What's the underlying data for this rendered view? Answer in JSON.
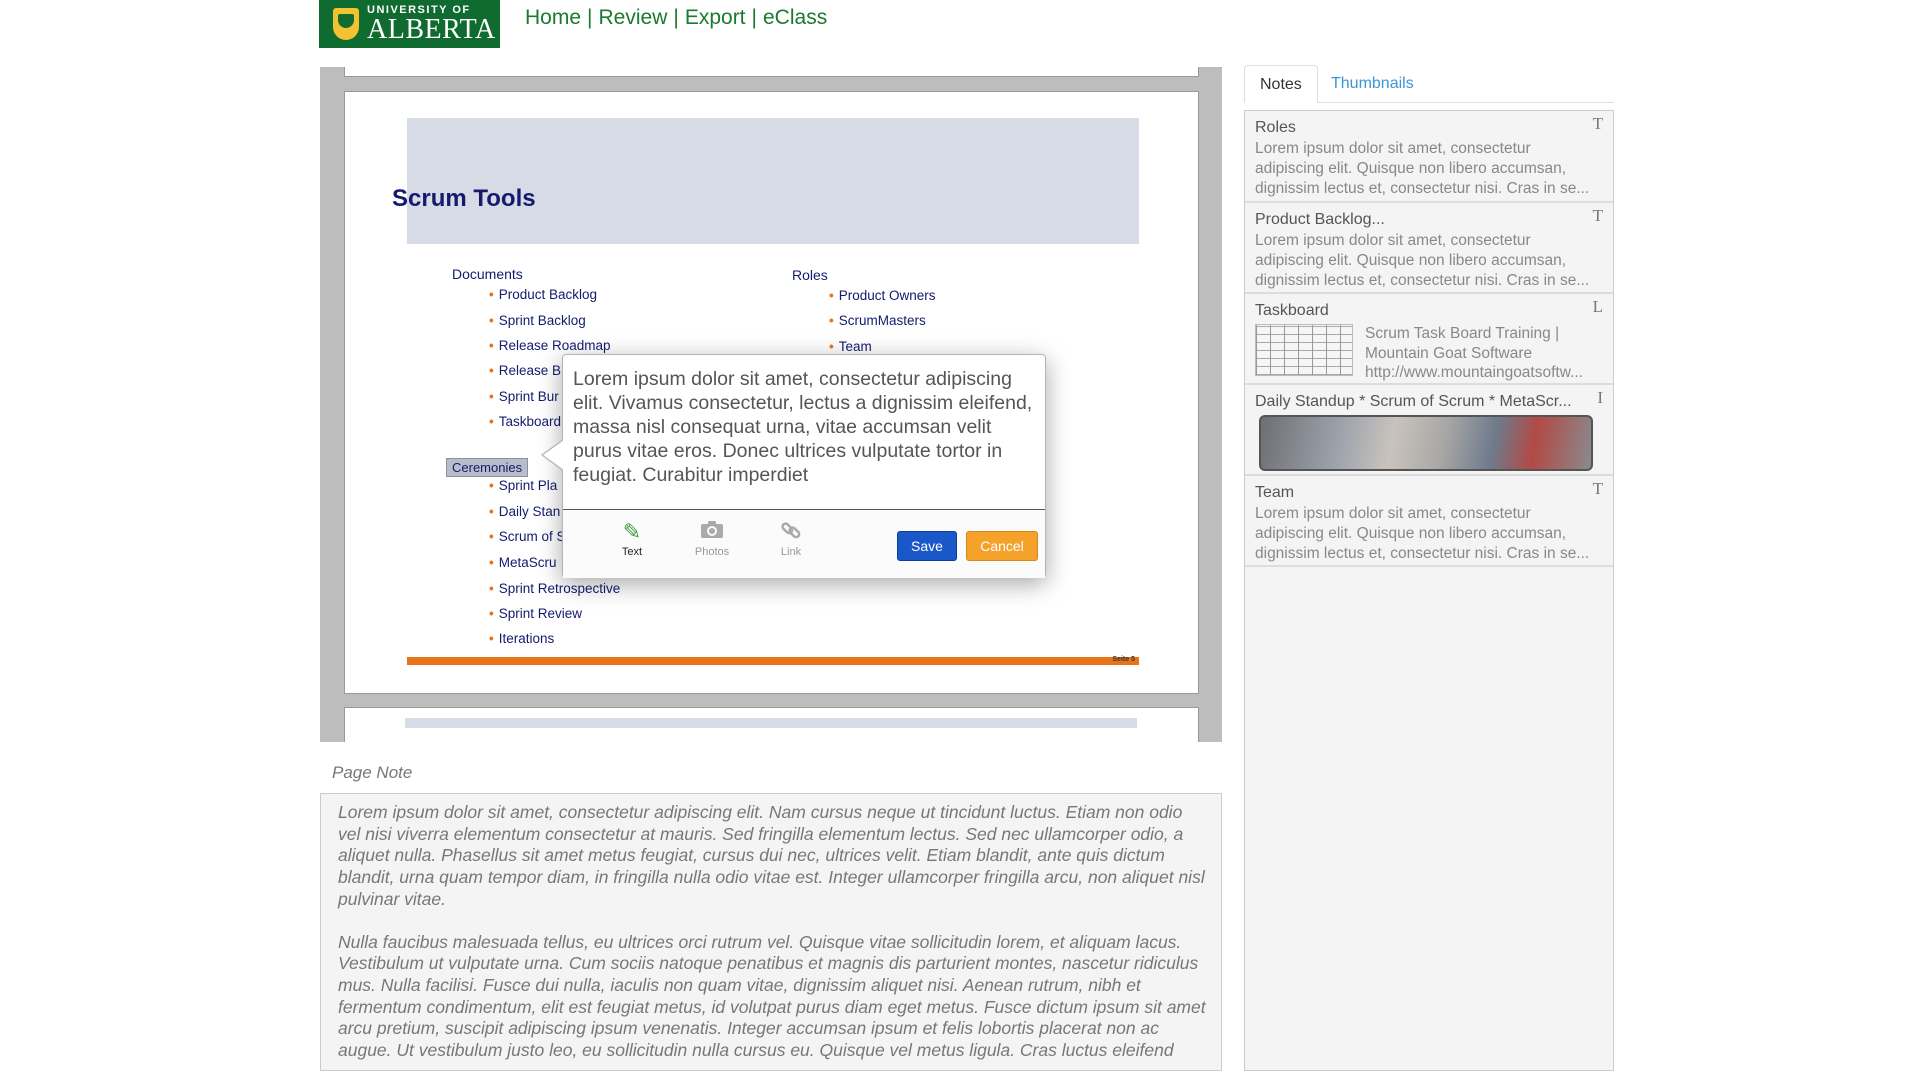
{
  "header": {
    "logo_small": "UNIVERSITY OF",
    "logo_big": "ALBERTA",
    "nav": [
      "Home",
      "Review",
      "Export",
      "eClass"
    ],
    "nav_separator": "|"
  },
  "slide": {
    "title": "Scrum Tools",
    "documents_heading": "Documents",
    "documents": [
      "Product Backlog",
      "Sprint Backlog",
      "Release Roadmap",
      "Release B",
      "Sprint Bur",
      "Taskboard"
    ],
    "roles_heading": "Roles",
    "roles": [
      "Product Owners",
      "ScrumMasters",
      "Team"
    ],
    "ceremonies_label": "Ceremonies",
    "ceremonies": [
      "Sprint Pla",
      "Daily Stan",
      "Scrum of S",
      "MetaScru",
      "Sprint Retrospective",
      "Sprint Review",
      "Iterations"
    ],
    "footer": "Seite 5"
  },
  "popup": {
    "text": "Lorem ipsum dolor sit amet, consectetur adipiscing elit. Vivamus consectetur, lectus a dignissim eleifend, massa nisl consequat urna, vitae accumsan velit purus vitae eros. Donec ultrices vulputate tortor in feugiat. Curabitur imperdiet",
    "tools": [
      "Text",
      "Photos",
      "Link"
    ],
    "save_label": "Save",
    "cancel_label": "Cancel"
  },
  "page_note": {
    "label": "Page Note",
    "paragraphs": [
      "Lorem ipsum dolor sit amet, consectetur adipiscing elit. Nam cursus neque ut tincidunt luctus. Etiam non odio vel nisi viverra elementum consectetur at mauris. Sed fringilla elementum lectus. Sed nec ullamcorper odio, a aliquet nulla. Phasellus sit amet metus feugiat, cursus dui nec, ultrices velit. Etiam blandit, ante quis dictum blandit, urna quam tempor diam, in fringilla nulla odio vitae est. Integer ullamcorper fringilla arcu, non aliquet nisl pulvinar vitae.",
      "Nulla faucibus malesuada tellus, eu ultrices orci rutrum vel. Quisque vitae sollicitudin lorem, et aliquam lacus. Vestibulum ut vulputate urna. Cum sociis natoque penatibus et magnis dis parturient montes, nascetur ridiculus mus. Nulla facilisi. Fusce dui nulla, iaculis non quam vitae, dignissim aliquet nisi. Aenean rutrum, nibh et fermentum condimentum, elit est feugiat metus, id volutpat purus diam eget metus. Fusce dictum ipsum sit amet arcu pretium, suscipit adipiscing ipsum venenatis. Integer accumsan ipsum et felis lobortis placerat non ac augue. Ut vestibulum justo leo, eu sollicitudin nulla cursus eu. Quisque vel metus ligula. Cras luctus eleifend"
    ]
  },
  "tabs": [
    "Notes",
    "Thumbnails"
  ],
  "notes": [
    {
      "title": "Roles",
      "body": "Lorem ipsum dolor sit amet, consectetur adipiscing elit. Quisque non libero accumsan, dignissim lectus et, consectetur nisi. Cras in se...",
      "type": "T"
    },
    {
      "title": "Product Backlog...",
      "body": "Lorem ipsum dolor sit amet, consectetur adipiscing elit. Quisque non libero accumsan, dignissim lectus et, consectetur nisi. Cras in se...",
      "type": "T"
    },
    {
      "title": "Taskboard",
      "link_title": "Scrum Task Board Training  |  Mountain Goat Software",
      "link_url": "http://www.mountaingoatsoftw...",
      "type": "L"
    },
    {
      "title": "Daily Standup * Scrum of Scrum * MetaScr...",
      "type": "I"
    },
    {
      "title": "Team",
      "body": "Lorem ipsum dolor sit amet, consectetur adipiscing elit. Quisque non libero accumsan, dignissim lectus et, consectetur nisi. Cras in se...",
      "type": "T"
    }
  ]
}
